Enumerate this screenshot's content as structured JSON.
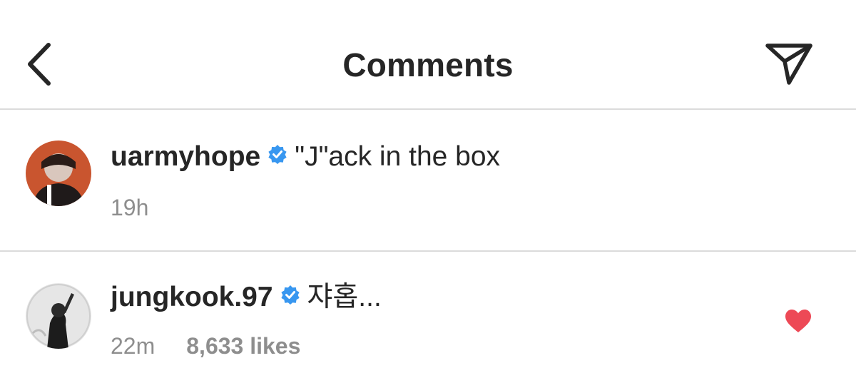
{
  "header": {
    "title": "Comments",
    "back_icon": "chevron-left-icon",
    "send_icon": "paper-plane-icon"
  },
  "comments": [
    {
      "username": "uarmyhope",
      "verified": true,
      "text": "\"J\"ack in the box",
      "time": "19h",
      "likes": "",
      "liked": false
    },
    {
      "username": "jungkook.97",
      "verified": true,
      "text": "쟈홉...",
      "time": "22m",
      "likes": "8,633 likes",
      "liked": true
    }
  ],
  "colors": {
    "text": "#262626",
    "secondary": "#8e8e8e",
    "divider": "#dbdbdb",
    "verified": "#3897f0",
    "heart": "#ed4956"
  }
}
